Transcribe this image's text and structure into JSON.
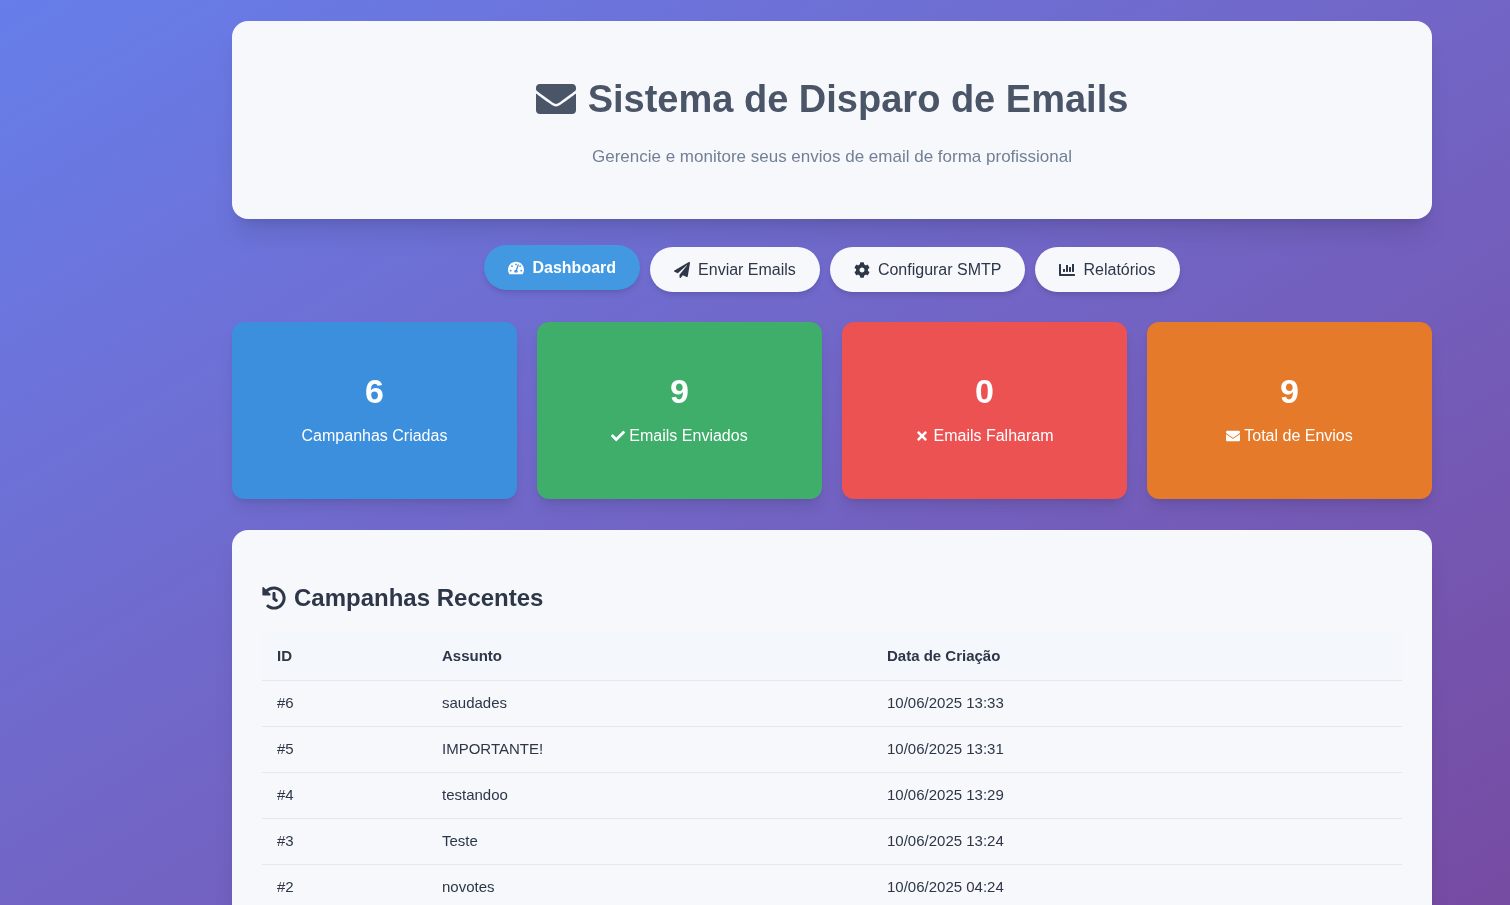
{
  "header": {
    "title": "Sistema de Disparo de Emails",
    "subtitle": "Gerencie e monitore seus envios de email de forma profissional"
  },
  "nav": [
    {
      "label": "Dashboard",
      "selected": true
    },
    {
      "label": "Enviar Emails",
      "selected": false
    },
    {
      "label": "Configurar SMTP",
      "selected": false
    },
    {
      "label": "Relatórios",
      "selected": false
    }
  ],
  "stats": [
    {
      "value": "6",
      "label": "Campanhas Criadas",
      "kind": "plain",
      "color": "#3b8fdc"
    },
    {
      "value": "9",
      "label": "Emails Enviados",
      "kind": "success",
      "color": "#3eae6a"
    },
    {
      "value": "0",
      "label": "Emails Falharam",
      "kind": "failure",
      "color": "#ec5252"
    },
    {
      "value": "9",
      "label": "Total de Envios",
      "kind": "total",
      "color": "#e47a2a"
    }
  ],
  "recent": {
    "title": "Campanhas Recentes",
    "columns": [
      "ID",
      "Assunto",
      "Data de Criação"
    ],
    "rows": [
      [
        "#6",
        "saudades",
        "10/06/2025 13:33"
      ],
      [
        "#5",
        "IMPORTANTE!",
        "10/06/2025 13:31"
      ],
      [
        "#4",
        "testandoo",
        "10/06/2025 13:29"
      ],
      [
        "#3",
        "Teste",
        "10/06/2025 13:24"
      ],
      [
        "#2",
        "novotes",
        "10/06/2025 04:24"
      ]
    ]
  }
}
